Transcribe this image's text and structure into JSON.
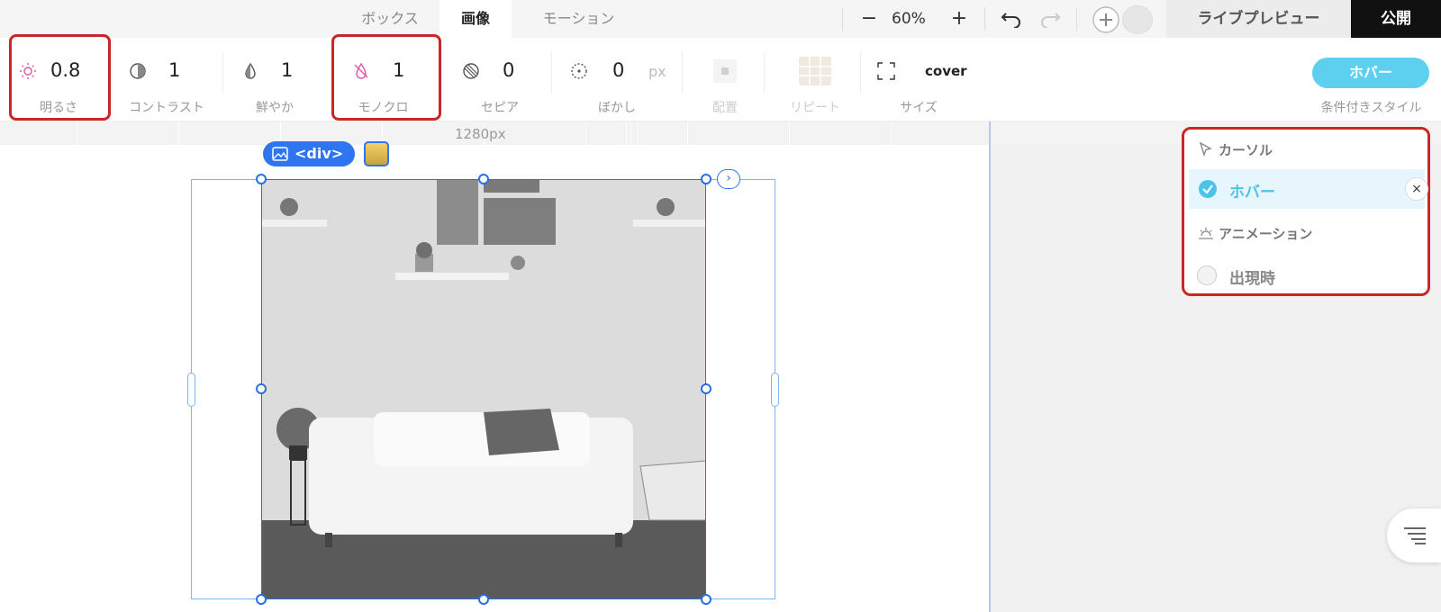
{
  "tabs": [
    {
      "label": "ボックス",
      "active": false
    },
    {
      "label": "画像",
      "active": true
    },
    {
      "label": "モーション",
      "active": false
    }
  ],
  "zoom": {
    "minus": "−",
    "value": "60%",
    "plus": "+"
  },
  "header": {
    "preview_label": "ライブプレビュー",
    "publish_label": "公開"
  },
  "toolbar": {
    "brightness": {
      "value": "0.8",
      "label": "明るさ"
    },
    "contrast": {
      "value": "1",
      "label": "コントラスト"
    },
    "saturate": {
      "value": "1",
      "label": "鮮やか"
    },
    "grayscale": {
      "value": "1",
      "label": "モノクロ"
    },
    "sepia": {
      "value": "0",
      "label": "セピア"
    },
    "blur": {
      "value": "0",
      "unit": "px",
      "label": "ぼかし"
    },
    "position": {
      "label": "配置"
    },
    "repeat": {
      "label": "リピート"
    },
    "size": {
      "value": "cover",
      "label": "サイズ"
    },
    "conditional": {
      "button_label": "ホバー",
      "label": "条件付きスタイル"
    }
  },
  "canvas": {
    "ruler_label": "1280px",
    "element_tag": "<div>"
  },
  "dropdown": {
    "cursor_heading": "カーソル",
    "hover_item": "ホバー",
    "animation_heading": "アニメーション",
    "appear_item": "出現時",
    "close_glyph": "×"
  },
  "colors": {
    "accent": "#2f74f0",
    "highlight": "#c62828",
    "hover": "#5dd0f0",
    "pink_icon": "#e055a8"
  }
}
